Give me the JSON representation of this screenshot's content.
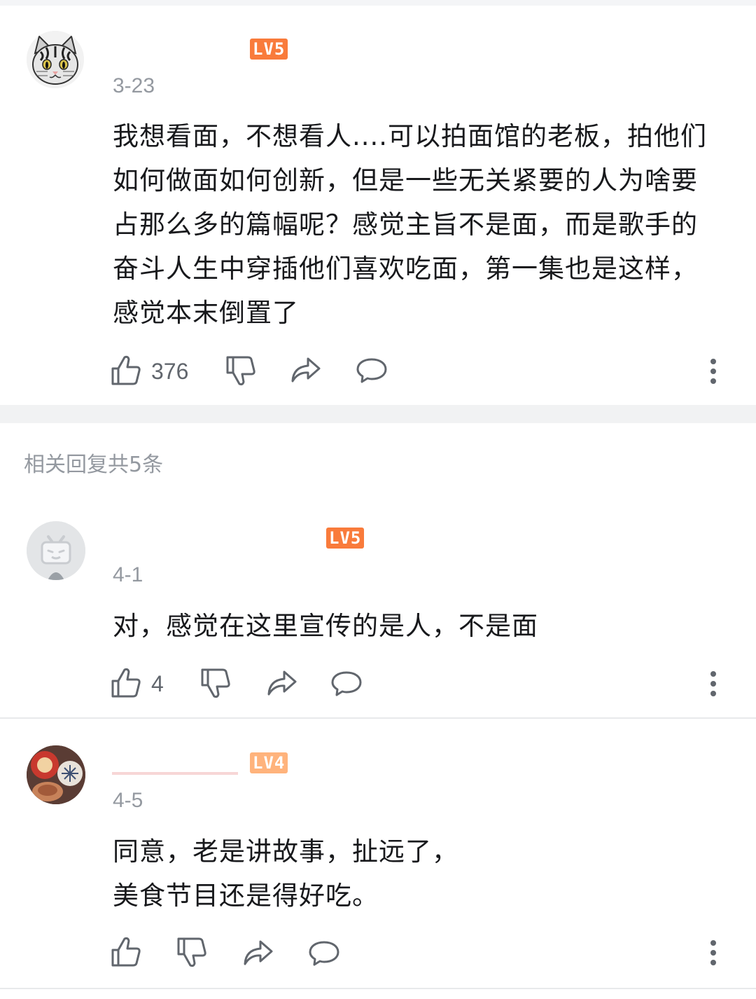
{
  "comment_main": {
    "level": "LV5",
    "date": "3-23",
    "content": "我想看面，不想看人....可以拍面馆的老板，拍他们如何做面如何创新，但是一些无关紧要的人为啥要占那么多的篇幅呢？感觉主旨不是面，而是歌手的奋斗人生中穿插他们喜欢吃面，第一集也是这样，感觉本末倒置了",
    "likes": "376"
  },
  "replies_header": "相关回复共5条",
  "reply1": {
    "level": "LV5",
    "date": "4-1",
    "content": "对，感觉在这里宣传的是人，不是面",
    "likes": "4"
  },
  "reply2": {
    "level": "LV4",
    "date": "4-5",
    "content_line1": "同意，老是讲故事，扯远了，",
    "content_line2": "美食节目还是得好吃。"
  },
  "colors": {
    "lv5": "#f97b3b",
    "lv4": "#ffb37c",
    "text": "#18191c",
    "meta": "#9499a0"
  },
  "icons": [
    "cat-avatar",
    "tv-avatar",
    "food-avatar",
    "thumb-up-icon",
    "thumb-down-icon",
    "share-icon",
    "reply-icon",
    "more-icon"
  ]
}
